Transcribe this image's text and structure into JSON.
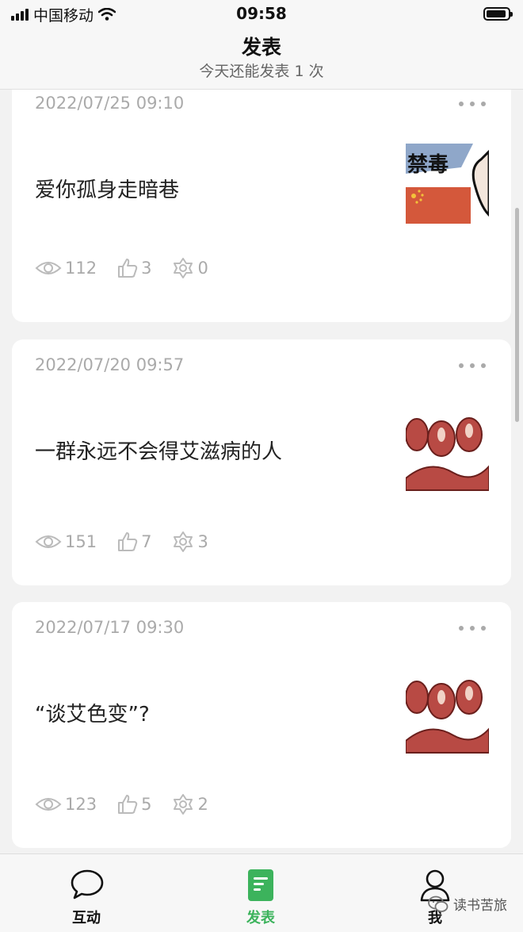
{
  "status_bar": {
    "carrier": "中国移动",
    "time": "09:58"
  },
  "header": {
    "title": "发表",
    "subtitle": "今天还能发表 1 次"
  },
  "posts": [
    {
      "date": "2022/07/25 09:10",
      "text": "爱你孤身走暗巷",
      "views": "112",
      "likes": "3",
      "shares": "0",
      "thumb": "禁毒"
    },
    {
      "date": "2022/07/20 09:57",
      "text": "一群永远不会得艾滋病的人",
      "views": "151",
      "likes": "7",
      "shares": "3",
      "thumb": ""
    },
    {
      "date": "2022/07/17 09:30",
      "text": "“谈艾色变”?",
      "views": "123",
      "likes": "5",
      "shares": "2",
      "thumb": ""
    }
  ],
  "tabs": [
    {
      "label": "互动",
      "icon": "chat-bubble-icon"
    },
    {
      "label": "发表",
      "icon": "document-icon",
      "active": true
    },
    {
      "label": "我",
      "icon": "person-icon"
    }
  ],
  "watermark": "读书苦旅",
  "colors": {
    "accent": "#3cb35c",
    "meta_gray": "#aaaaaa"
  }
}
